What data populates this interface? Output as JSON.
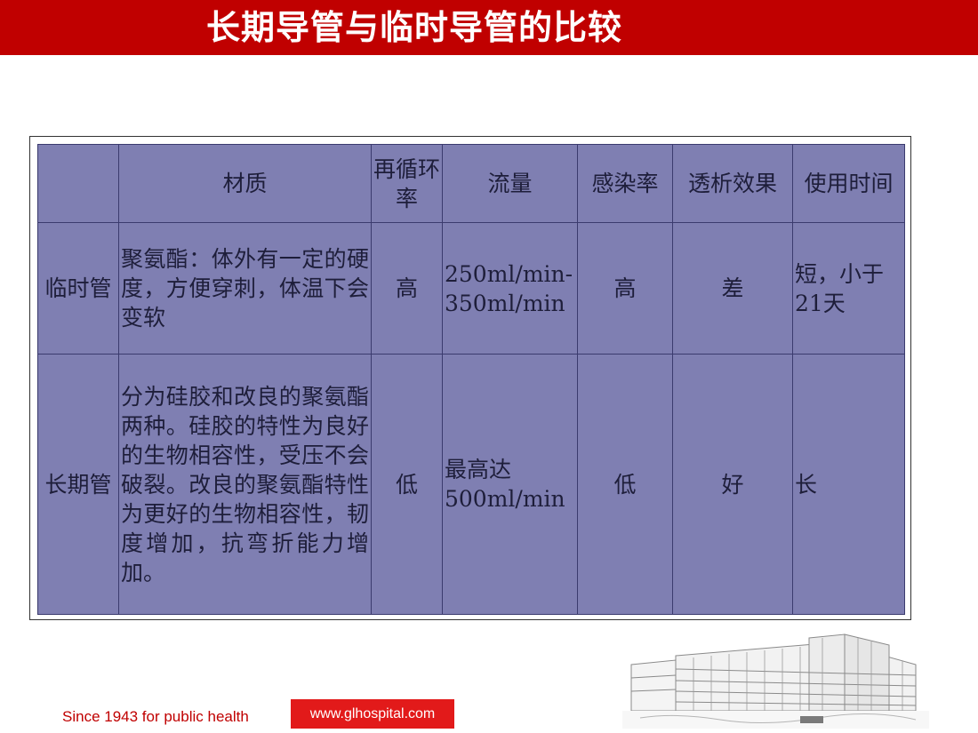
{
  "title": "长期导管与临时导管的比较",
  "table": {
    "headers": [
      "",
      "材质",
      "再循环率",
      "流量",
      "感染率",
      "透析效果",
      "使用时间"
    ],
    "rows": [
      {
        "label": "临时管",
        "material": "聚氨酯：体外有一定的硬度，方便穿刺，体温下会变软",
        "recirculation": "高",
        "flow": "250ml/min-350ml/min",
        "infection": "高",
        "effect": "差",
        "duration": "短，小于21天"
      },
      {
        "label": "长期管",
        "material": "分为硅胶和改良的聚氨酯两种。硅胶的特性为良好的生物相容性，受压不会破裂。改良的聚氨酯特性为更好的生物相容性，韧度增加，抗弯折能力增加。",
        "recirculation": "低",
        "flow": "最高达500ml/min",
        "infection": "低",
        "effect": "好",
        "duration": "长"
      }
    ]
  },
  "footer": {
    "slogan": "Since 1943 for public health",
    "url": "www.glhospital.com"
  },
  "colors": {
    "title_bar": "#c00000",
    "table_fill": "#7f7fb2",
    "url_box": "#e21a1a"
  },
  "images": {
    "building": "hospital-building-sketch"
  }
}
